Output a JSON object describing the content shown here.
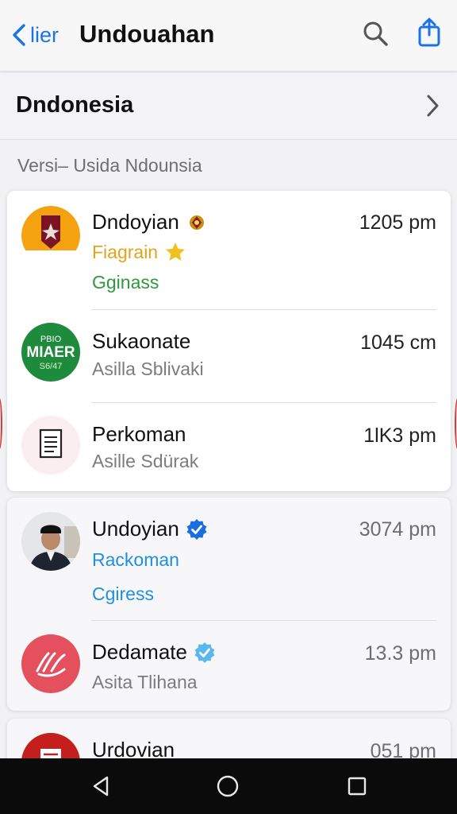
{
  "header": {
    "back_label": "lier",
    "title": "Undouahan"
  },
  "country": {
    "label": "Dndonesia"
  },
  "section": {
    "label": "Versi– Usida Ndounsia"
  },
  "chats": [
    {
      "name": "Dndoyian",
      "time": "1205 pm",
      "line1": "Fiagrain",
      "line2": "Gginass"
    },
    {
      "name": "Sukaonate",
      "time": "1045 cm",
      "line1": "Asilla Sblivaki",
      "avatar_text_top": "PBIO",
      "avatar_text_mid": "MIAER",
      "avatar_text_bot": "S6/47"
    },
    {
      "name": "Perkoman",
      "time": "1lK3 pm",
      "line1": "Asille Sdürak"
    },
    {
      "name": "Undoyian",
      "time": "3074 pm",
      "line1": "Rackoman",
      "line2": "Cgiress"
    },
    {
      "name": "Dedamate",
      "time": "13.3 pm",
      "line1": "Asita Tlihana"
    },
    {
      "name": "Urdovian",
      "time": "051 pm"
    }
  ],
  "colors": {
    "accent": "#1a73e8",
    "gold": "#e5a21a",
    "green": "#2e9a3a",
    "blue_sub": "#1f8fe0",
    "verified_dark": "#1a6fe0",
    "verified_light": "#5ab8ef",
    "navbar": "#0b0b0c"
  },
  "icons": {
    "back": "chevron-left-icon",
    "search": "search-icon",
    "share": "share-icon",
    "chevron": "chevron-right-icon",
    "nav_back": "triangle-back-icon",
    "nav_home": "circle-home-icon",
    "nav_recent": "square-recent-icon"
  }
}
